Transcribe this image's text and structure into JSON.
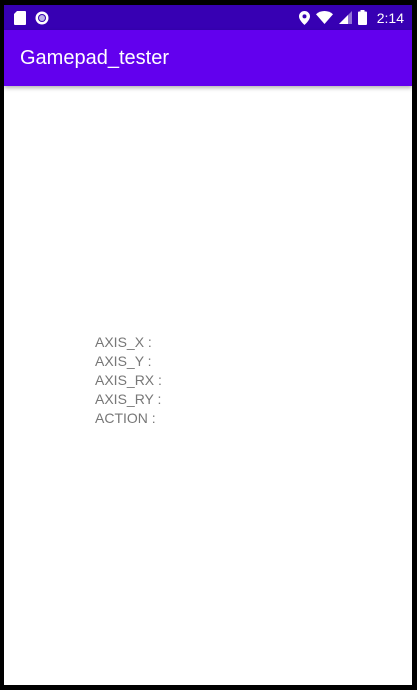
{
  "status_bar": {
    "left_icons": [
      "sd-card-icon",
      "circle-notification-icon"
    ],
    "right_icons": [
      "location-icon",
      "wifi-icon",
      "signal-icon",
      "battery-icon"
    ],
    "time": "2:14",
    "color": "#3700b3"
  },
  "app_bar": {
    "title": "Gamepad_tester",
    "color": "#6200ee"
  },
  "readout": {
    "axis_x_label": "AXIS_X :",
    "axis_y_label": "AXIS_Y :",
    "axis_rx_label": "AXIS_RX :",
    "axis_ry_label": "AXIS_RY :",
    "action_label": "ACTION :"
  }
}
